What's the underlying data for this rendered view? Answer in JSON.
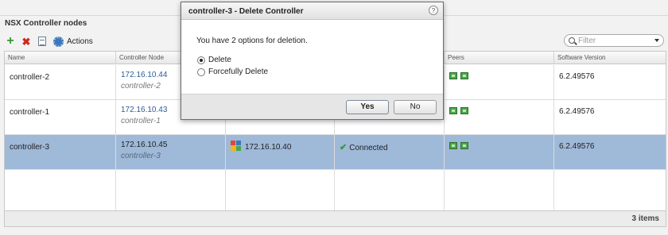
{
  "panel": {
    "title": "NSX Controller nodes"
  },
  "toolbar": {
    "add_icon": "+",
    "delete_icon": "✖",
    "actions_label": "Actions"
  },
  "filter": {
    "placeholder": "Filter"
  },
  "table": {
    "columns": [
      "Name",
      "Controller Node",
      "",
      "",
      "Peers",
      "Software Version"
    ],
    "rows": [
      {
        "name": "controller-2",
        "ip": "172.16.10.44",
        "node": "controller-2",
        "manager": "",
        "status": "",
        "version": "6.2.49576"
      },
      {
        "name": "controller-1",
        "ip": "172.16.10.43",
        "node": "controller-1",
        "manager": "",
        "status": "",
        "version": "6.2.49576"
      },
      {
        "name": "controller-3",
        "ip": "172.16.10.45",
        "node": "controller-3",
        "manager": "172.16.10.40",
        "status": "Connected",
        "version": "6.2.49576"
      }
    ],
    "items_count": "3 items"
  },
  "dialog": {
    "title": "controller-3 - Delete Controller",
    "help": "?",
    "message": "You have 2 options for deletion.",
    "options": [
      "Delete",
      "Forcefully Delete"
    ],
    "selected_option": "Delete",
    "yes_label": "Yes",
    "no_label": "No"
  },
  "colors": {
    "selection": "#9fb9d8",
    "link": "#2b5d9a",
    "connected": "#2f9b2f"
  }
}
